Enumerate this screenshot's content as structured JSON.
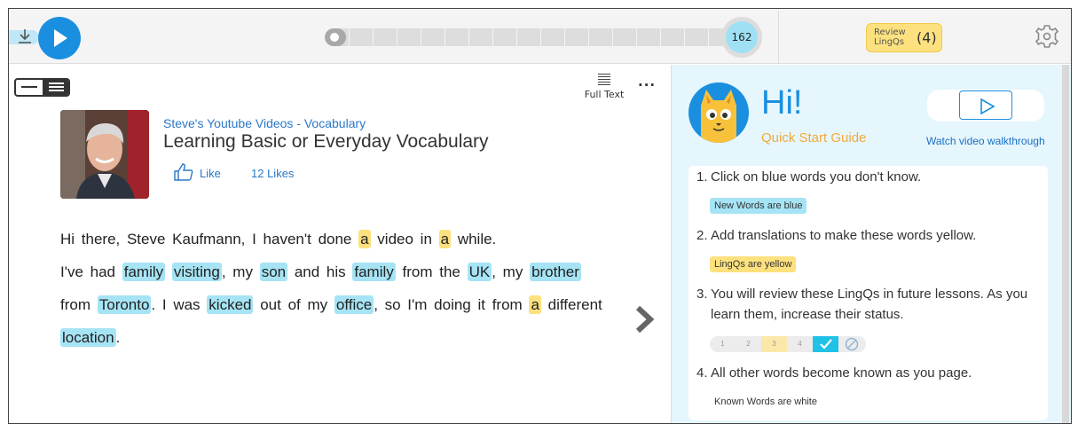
{
  "player": {
    "download_icon": "download-icon",
    "play_icon": "play-icon",
    "progress": 0.02,
    "page_count": "162"
  },
  "review": {
    "label": "Review LingQs",
    "count": "(4)"
  },
  "settings_icon": "gear-icon",
  "reader": {
    "full_text_label": "Full Text",
    "more_label": "···",
    "course": "Steve's Youtube Videos - Vocabulary",
    "title": "Learning Basic or Everyday Vocabulary",
    "like_label": "Like",
    "likes_count": "12 Likes",
    "paragraphs": [
      [
        {
          "t": "Hi there, Steve Kaufmann, I haven't done "
        },
        {
          "t": "a",
          "s": "yellow"
        },
        {
          "t": " video in "
        },
        {
          "t": "a",
          "s": "yellow"
        },
        {
          "t": " while."
        }
      ],
      [
        {
          "t": "I've had "
        },
        {
          "t": "family",
          "s": "blue"
        },
        {
          "t": " "
        },
        {
          "t": "visiting",
          "s": "blue"
        },
        {
          "t": ", my "
        },
        {
          "t": "son",
          "s": "blue"
        },
        {
          "t": " and his "
        },
        {
          "t": "family",
          "s": "blue"
        },
        {
          "t": " from the "
        },
        {
          "t": "UK",
          "s": "blue"
        },
        {
          "t": ", my "
        },
        {
          "t": "brother",
          "s": "blue"
        },
        {
          "t": " from "
        },
        {
          "t": "Toronto",
          "s": "blue"
        },
        {
          "t": ". I was "
        },
        {
          "t": "kicked",
          "s": "blue"
        },
        {
          "t": " out of my "
        },
        {
          "t": "office",
          "s": "blue"
        },
        {
          "t": ", so I'm doing it from "
        },
        {
          "t": "a",
          "s": "yellow"
        },
        {
          "t": " different "
        },
        {
          "t": "location",
          "s": "blue"
        },
        {
          "t": "."
        }
      ]
    ]
  },
  "guide": {
    "greeting": "Hi!",
    "subtitle": "Quick Start Guide",
    "watch_label": "Watch video walkthrough",
    "steps": [
      {
        "n": "1.",
        "text": "Click on blue words you don't know.",
        "pill": "New Words are blue"
      },
      {
        "n": "2.",
        "text": "Add translations to make these words yellow.",
        "pill": "LingQs are yellow"
      },
      {
        "n": "3.",
        "text": "You will review these LingQs in future lessons. As you learn them, increase their status."
      },
      {
        "n": "4.",
        "text": "All other words become known as you page.",
        "pill": "Known Words are white"
      }
    ],
    "status_levels": [
      "1",
      "2",
      "3",
      "4"
    ]
  },
  "colors": {
    "accent": "#1a8fe0",
    "new_word": "#a6e4f5",
    "lingq": "#fde17e",
    "panel_bg": "#e5f6fd"
  }
}
